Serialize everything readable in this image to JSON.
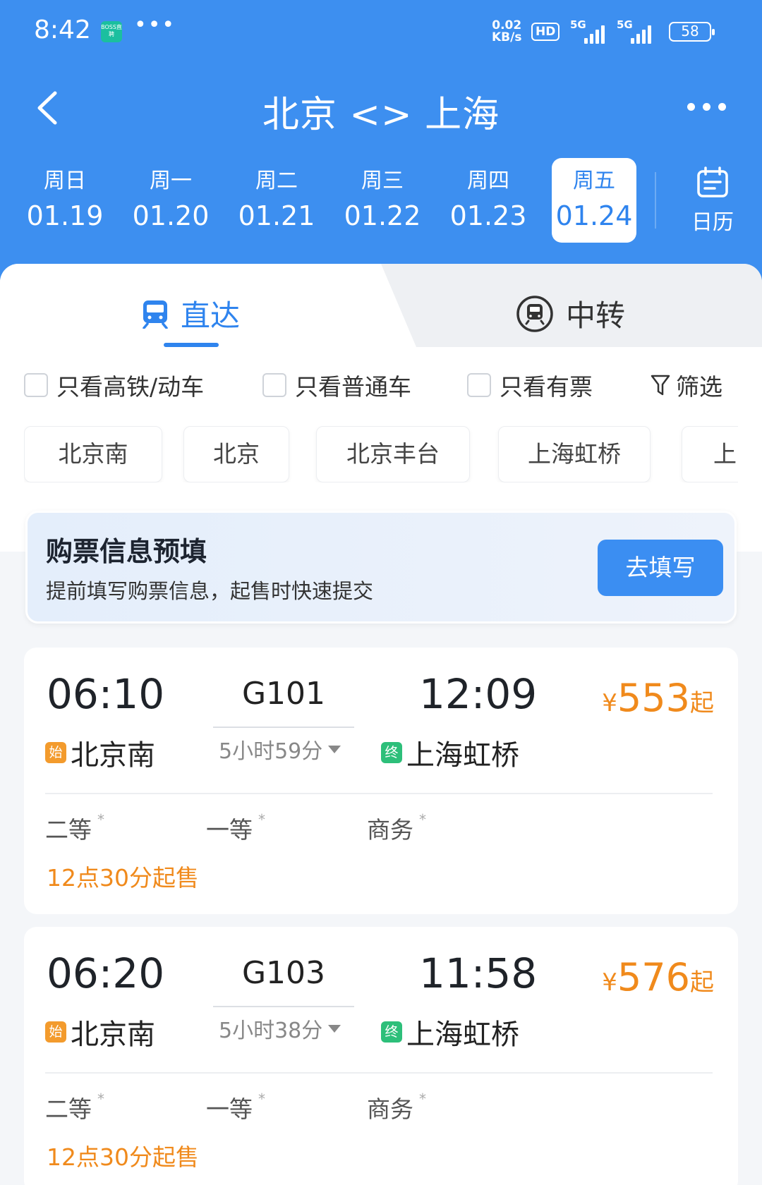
{
  "status": {
    "time": "8:42",
    "app_badge": "BOSS直聘",
    "dots": "•••",
    "net_speed_top": "0.02",
    "net_speed_unit": "KB/s",
    "hd": "HD",
    "signal1": "5G",
    "signal2": "5G",
    "battery": "58"
  },
  "nav": {
    "title": "北京 <> 上海"
  },
  "dates": [
    {
      "week": "周日",
      "date": "01.19"
    },
    {
      "week": "周一",
      "date": "01.20"
    },
    {
      "week": "周二",
      "date": "01.21"
    },
    {
      "week": "周三",
      "date": "01.22"
    },
    {
      "week": "周四",
      "date": "01.23"
    },
    {
      "week": "周五",
      "date": "01.24",
      "selected": true
    }
  ],
  "calendar_label": "日历",
  "tabs": {
    "direct": "直达",
    "transfer": "中转"
  },
  "filters": {
    "high_speed": "只看高铁/动车",
    "normal": "只看普通车",
    "available": "只看有票",
    "filter": "筛选"
  },
  "stations": [
    "北京南",
    "北京",
    "北京丰台",
    "上海虹桥",
    "上"
  ],
  "prefill": {
    "title": "购票信息预填",
    "subtitle": "提前填写购票信息，起售时快速提交",
    "button": "去填写"
  },
  "trains": [
    {
      "dep_time": "06:10",
      "arr_time": "12:09",
      "code": "G101",
      "duration": "5小时59分",
      "from_badge": "始",
      "from": "北京南",
      "to_badge": "终",
      "to": "上海虹桥",
      "price_symbol": "¥",
      "price": "553",
      "price_suffix": "起",
      "seats": [
        "二等",
        "一等",
        "商务"
      ],
      "seat_mark": "*",
      "sale_info": "12点30分起售"
    },
    {
      "dep_time": "06:20",
      "arr_time": "11:58",
      "code": "G103",
      "duration": "5小时38分",
      "from_badge": "始",
      "from": "北京南",
      "to_badge": "终",
      "to": "上海虹桥",
      "price_symbol": "¥",
      "price": "576",
      "price_suffix": "起",
      "seats": [
        "二等",
        "一等",
        "商务"
      ],
      "seat_mark": "*",
      "sale_info": "12点30分起售"
    }
  ],
  "colors": {
    "primary": "#3d8ff0",
    "price": "#f08a1c",
    "start_badge": "#f39b2d",
    "end_badge": "#2dbf7a"
  }
}
